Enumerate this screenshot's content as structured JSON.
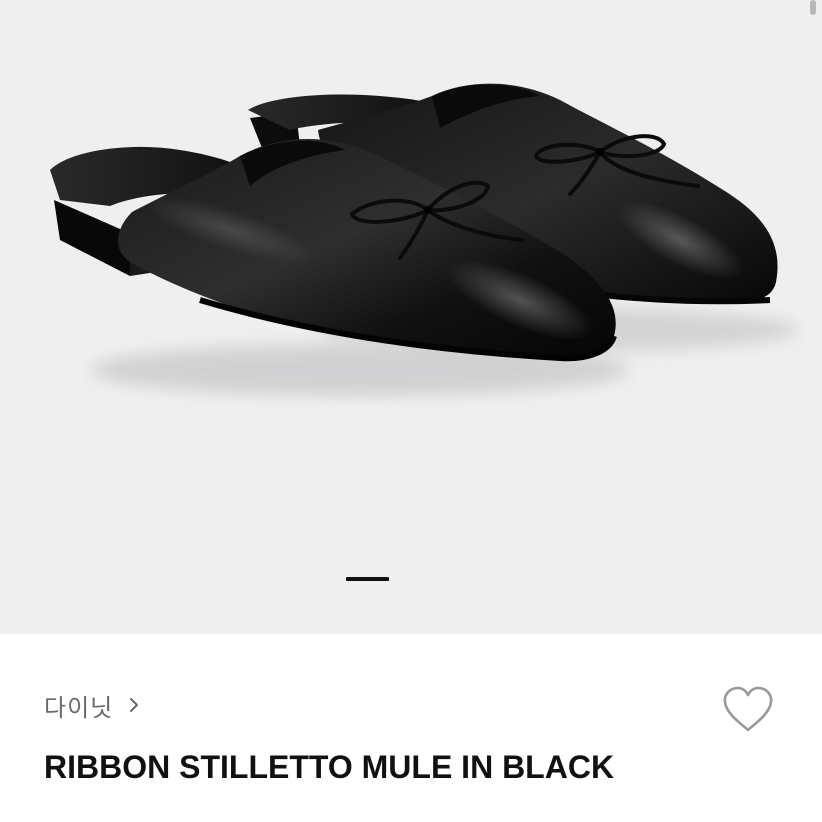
{
  "gallery": {
    "image_subject": "black-leather-ribbon-mule-shoes",
    "background_color": "#efeff0",
    "current_slide": 1
  },
  "product": {
    "brand": "다이닛",
    "title": "RIBBON STILLETTO MULE IN BLACK"
  },
  "icons": {
    "brand_chevron": "chevron-right-icon",
    "wishlist": "heart-outline-icon"
  },
  "colors": {
    "title_text": "#111111",
    "brand_text": "#6a6a6a",
    "heart_outline": "#9a9a9a",
    "indicator_active": "#111111"
  }
}
